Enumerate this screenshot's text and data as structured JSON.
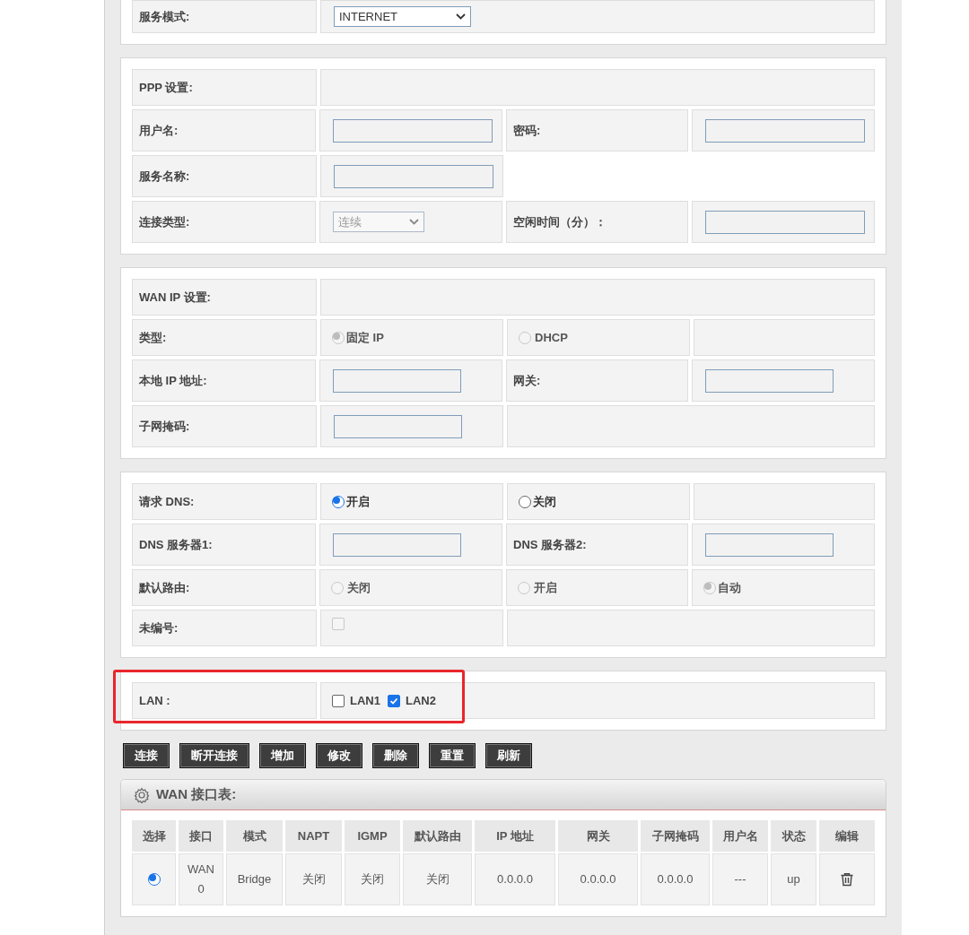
{
  "sections": [
    {
      "rows": [
        {
          "cells": [
            {
              "kind": "label",
              "text": "服务模式:"
            },
            {
              "kind": "select",
              "value": "INTERNET",
              "disabled": false
            }
          ]
        }
      ]
    },
    {
      "rows": [
        {
          "cells": [
            {
              "kind": "label",
              "text": "PPP 设置:"
            },
            {
              "kind": "blank"
            }
          ]
        },
        {
          "cells": [
            {
              "kind": "label",
              "text": "用户名:"
            },
            {
              "kind": "input"
            },
            {
              "kind": "label",
              "text": "密码:"
            },
            {
              "kind": "input"
            }
          ]
        },
        {
          "cells": [
            {
              "kind": "label",
              "text": "服务名称:"
            },
            {
              "kind": "input"
            }
          ]
        },
        {
          "cells": [
            {
              "kind": "label",
              "text": "连接类型:"
            },
            {
              "kind": "select",
              "value": "连续",
              "disabled": true
            },
            {
              "kind": "label",
              "text": "空闲时间（分）："
            },
            {
              "kind": "input"
            }
          ]
        }
      ]
    },
    {
      "rows": [
        {
          "cells": [
            {
              "kind": "label",
              "text": "WAN IP 设置:"
            },
            {
              "kind": "blank"
            }
          ]
        },
        {
          "cells": [
            {
              "kind": "label",
              "text": "类型:"
            },
            {
              "kind": "radio",
              "text": "固定 IP",
              "selected": true,
              "disabled": true
            },
            {
              "kind": "radio",
              "text": "DHCP",
              "selected": false,
              "disabled": true
            },
            {
              "kind": "blank"
            }
          ]
        },
        {
          "cells": [
            {
              "kind": "label",
              "text": "本地 IP 地址:"
            },
            {
              "kind": "input"
            },
            {
              "kind": "label",
              "text": "网关:"
            },
            {
              "kind": "input"
            }
          ]
        },
        {
          "cells": [
            {
              "kind": "label",
              "text": "子网掩码:"
            },
            {
              "kind": "input"
            },
            {
              "kind": "blank"
            }
          ]
        }
      ]
    },
    {
      "rows": [
        {
          "cells": [
            {
              "kind": "label",
              "text": "请求 DNS:"
            },
            {
              "kind": "radio",
              "text": "开启",
              "selected": true,
              "disabled": false
            },
            {
              "kind": "radio",
              "text": "关闭",
              "selected": false,
              "disabled": false
            },
            {
              "kind": "blank"
            }
          ]
        },
        {
          "cells": [
            {
              "kind": "label",
              "text": "DNS 服务器1:"
            },
            {
              "kind": "input"
            },
            {
              "kind": "label",
              "text": "DNS 服务器2:"
            },
            {
              "kind": "input"
            }
          ]
        },
        {
          "cells": [
            {
              "kind": "label",
              "text": "默认路由:"
            },
            {
              "kind": "radio",
              "text": "关闭",
              "selected": false,
              "disabled": true
            },
            {
              "kind": "radio",
              "text": "开启",
              "selected": false,
              "disabled": true
            },
            {
              "kind": "radio",
              "text": "自动",
              "selected": true,
              "disabled": true
            }
          ]
        },
        {
          "cells": [
            {
              "kind": "label",
              "text": "未编号:"
            },
            {
              "kind": "checkbox",
              "checked": false,
              "disabled": true
            },
            {
              "kind": "blank"
            }
          ]
        }
      ]
    },
    {
      "highlighted": true,
      "rows": [
        {
          "cells": [
            {
              "kind": "label",
              "text": "LAN :"
            },
            {
              "kind": "checks",
              "items": [
                {
                  "text": "LAN1",
                  "checked": false
                },
                {
                  "text": "LAN2",
                  "checked": true
                }
              ]
            }
          ]
        }
      ]
    }
  ],
  "buttons": [
    "连接",
    "断开连接",
    "增加",
    "修改",
    "删除",
    "重置",
    "刷新"
  ],
  "wan_table": {
    "title": "WAN 接口表:",
    "columns": [
      "选择",
      "接口",
      "模式",
      "NAPT",
      "IGMP",
      "默认路由",
      "IP 地址",
      "网关",
      "子网掩码",
      "用户名",
      "状态",
      "编辑"
    ],
    "rows": [
      {
        "cells": [
          {
            "kind": "radio",
            "selected": true
          },
          "WAN 0",
          "Bridge",
          "关闭",
          "关闭",
          "关闭",
          "0.0.0.0",
          "0.0.0.0",
          "0.0.0.0",
          "---",
          "up",
          {
            "kind": "delete"
          }
        ]
      }
    ]
  }
}
